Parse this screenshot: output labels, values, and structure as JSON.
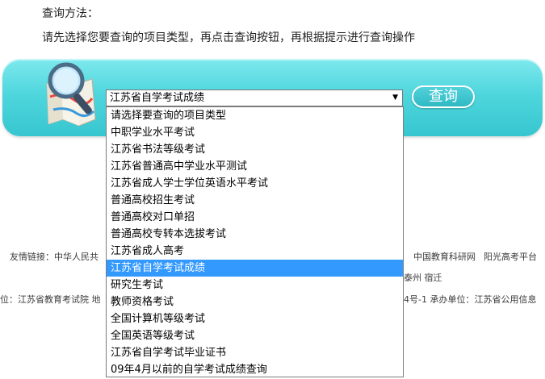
{
  "instructions": {
    "heading": "查询方法：",
    "body": "请先选择您要查询的项目类型，再点击查询按钮，再根据提示进行查询操作"
  },
  "query": {
    "selected_value": "江苏省自学考试成绩",
    "button_label": "查询",
    "illustration_icon": "magnifier-map-icon",
    "bar_color": "#4fd6dd"
  },
  "dropdown": {
    "options": [
      "请选择要查询的项目类型",
      "中职学业水平考试",
      "江苏省书法等级考试",
      "江苏省普通高中学业水平测试",
      "江苏省成人学士学位英语水平考试",
      "普通高校招生考试",
      "普通高校对口单招",
      "普通高校专转本选拔考试",
      "江苏省成人高考",
      "江苏省自学考试成绩",
      "研究生考试",
      "教师资格考试",
      "全国计算机等级考试",
      "全国英语等级考试",
      "江苏省自学考试毕业证书",
      "09年4月以前的自学考试成绩查询"
    ],
    "highlight_color": "#3399ff"
  },
  "footer": {
    "links_label": "友情链接：中华人民共",
    "links_right": [
      "中国教育科研网",
      "阳光高考平台"
    ],
    "cities_tail": "泰州  宿迁",
    "host_prefix": "位：江苏省教育考试院  地",
    "host_suffix": "4号-1  承办单位：江苏省公用信息"
  }
}
